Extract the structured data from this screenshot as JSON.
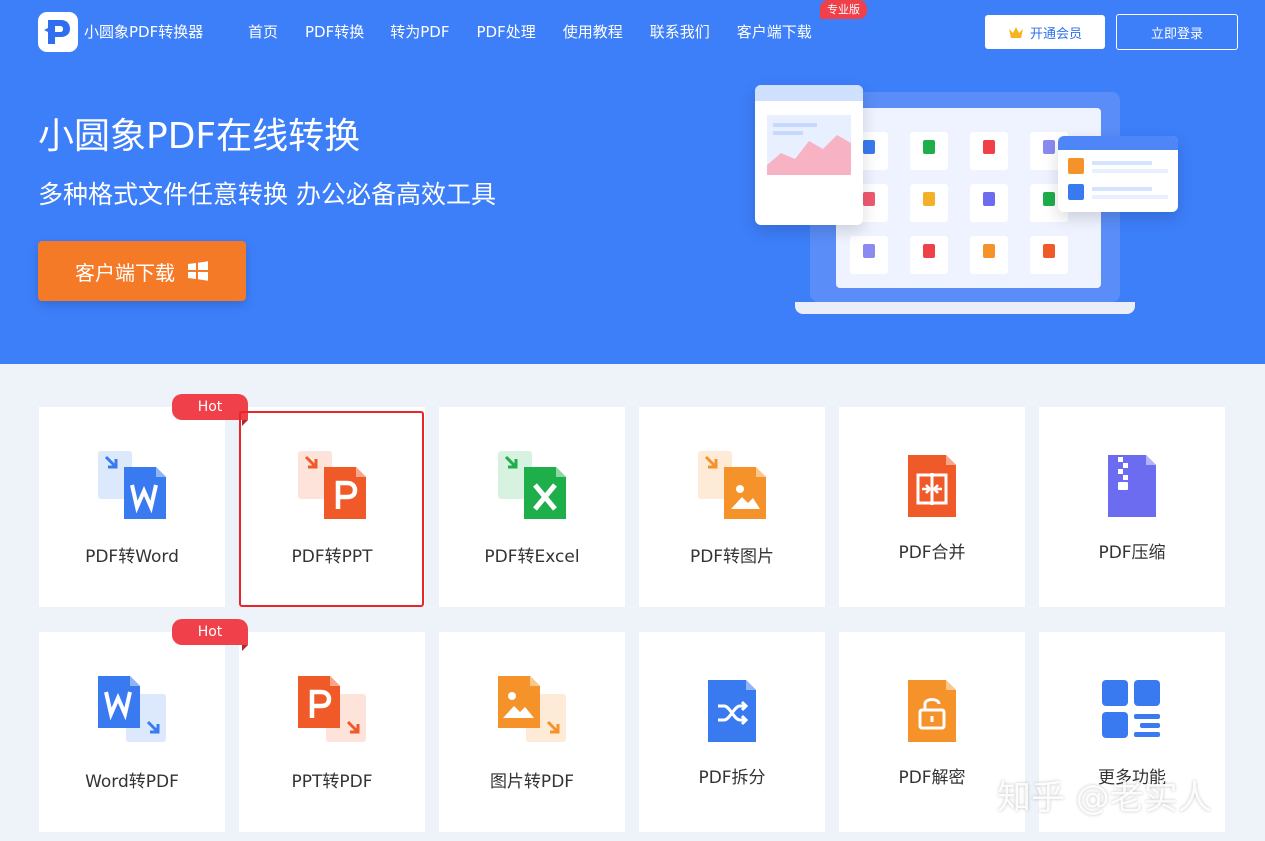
{
  "brand": {
    "name": "小圆象PDF转换器"
  },
  "nav": [
    "首页",
    "PDF转换",
    "转为PDF",
    "PDF处理",
    "使用教程",
    "联系我们",
    "客户端下载"
  ],
  "pro_badge": "专业版",
  "header_buttons": {
    "vip": "开通会员",
    "login": "立即登录"
  },
  "hero": {
    "title": "小圆象PDF在线转换",
    "subtitle": "多种格式文件任意转换 办公必备高效工具",
    "download_label": "客户端下载"
  },
  "colors": {
    "hero_blue": "#3d7ef9",
    "download_orange": "#f47a28",
    "hot_red": "#f0404a",
    "word_blue": "#3a7af0",
    "ppt_orange": "#f05a28",
    "excel_green": "#1eae4a",
    "image_orange": "#f5922a",
    "compress_purple": "#6c6cf0"
  },
  "tools_row1": [
    {
      "label": "PDF转Word",
      "icon": "pdf-to-word-icon",
      "hot": "Hot"
    },
    {
      "label": "PDF转PPT",
      "icon": "pdf-to-ppt-icon",
      "selected": true
    },
    {
      "label": "PDF转Excel",
      "icon": "pdf-to-excel-icon"
    },
    {
      "label": "PDF转图片",
      "icon": "pdf-to-image-icon"
    },
    {
      "label": "PDF合并",
      "icon": "pdf-merge-icon"
    },
    {
      "label": "PDF压缩",
      "icon": "pdf-compress-icon"
    }
  ],
  "tools_row2": [
    {
      "label": "Word转PDF",
      "icon": "word-to-pdf-icon",
      "hot": "Hot"
    },
    {
      "label": "PPT转PDF",
      "icon": "ppt-to-pdf-icon"
    },
    {
      "label": "图片转PDF",
      "icon": "image-to-pdf-icon"
    },
    {
      "label": "PDF拆分",
      "icon": "pdf-split-icon"
    },
    {
      "label": "PDF解密",
      "icon": "pdf-decrypt-icon"
    },
    {
      "label": "更多功能",
      "icon": "more-features-icon"
    }
  ],
  "watermark": "知乎 @老实人"
}
